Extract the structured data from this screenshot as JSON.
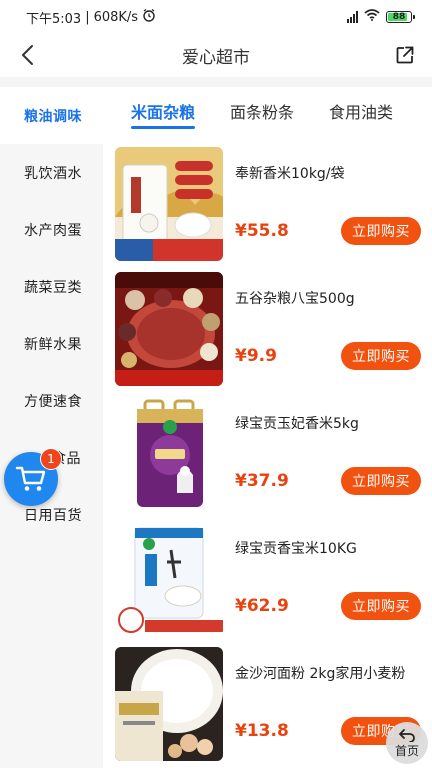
{
  "status_bar": {
    "time": "下午5:03",
    "speed": "608K/s",
    "battery": "88"
  },
  "header": {
    "title": "爱心超市"
  },
  "sidebar": {
    "items": [
      {
        "label": "粮油调味",
        "active": true
      },
      {
        "label": "乳饮酒水",
        "active": false
      },
      {
        "label": "水产肉蛋",
        "active": false
      },
      {
        "label": "蔬菜豆类",
        "active": false
      },
      {
        "label": "新鲜水果",
        "active": false
      },
      {
        "label": "方便速食",
        "active": false
      },
      {
        "label": "食品",
        "active": false
      },
      {
        "label": "日用百货",
        "active": false
      }
    ]
  },
  "tabs": [
    {
      "label": "米面杂粮",
      "active": true
    },
    {
      "label": "面条粉条",
      "active": false
    },
    {
      "label": "食用油类",
      "active": false
    }
  ],
  "products": [
    {
      "name": "奉新香米10kg/袋",
      "price": "¥55.8",
      "buy_label": "立即购买",
      "image": "rice-bag-image",
      "img_text_1": "奉新香米",
      "img_text_2": "一年一季 现磨现发"
    },
    {
      "name": "五谷杂粮八宝500g",
      "price": "¥9.9",
      "buy_label": "立即购买",
      "image": "mixed-grains-image",
      "img_text_1": "八宝米500G",
      "img_text_2": "营养美味 安全主粮"
    },
    {
      "name": "绿宝贡玉妃香米5kg",
      "price": "¥37.9",
      "buy_label": "立即购买",
      "image": "purple-rice-bag-image",
      "img_text_1": "玉妃香米",
      "img_text_2": ""
    },
    {
      "name": "绿宝贡香宝米10KG",
      "price": "¥62.9",
      "buy_label": "立即购买",
      "image": "white-rice-bag-image",
      "img_text_1": "香宝米",
      "img_text_2": "一年一季 香软爽口"
    },
    {
      "name": "金沙河面粉 2kg家用小麦粉",
      "price": "¥13.8",
      "buy_label": "立即购买",
      "image": "flour-bag-image",
      "img_text_1": "",
      "img_text_2": ""
    }
  ],
  "cart": {
    "badge_count": "1"
  },
  "home_button": {
    "label": "首页"
  },
  "colors": {
    "accent": "#1a73e8",
    "buy_button": "#f2520f",
    "price": "#e8430f",
    "cart_fab": "#1f87ee"
  }
}
